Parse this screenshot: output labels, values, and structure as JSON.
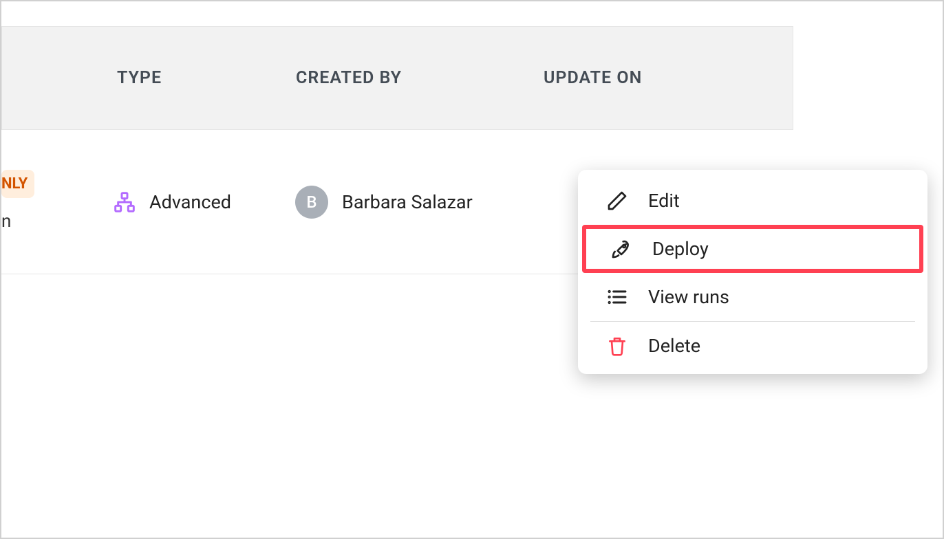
{
  "table": {
    "headers": {
      "type": "TYPE",
      "created_by": "CREATED BY",
      "update_on": "UPDATE ON"
    },
    "row": {
      "badge_partial": "NLY",
      "sub_partial": "n",
      "type_label": "Advanced",
      "creator_initial": "B",
      "creator_name": "Barbara Salazar"
    }
  },
  "menu": {
    "edit": "Edit",
    "deploy": "Deploy",
    "view_runs": "View runs",
    "delete": "Delete"
  }
}
